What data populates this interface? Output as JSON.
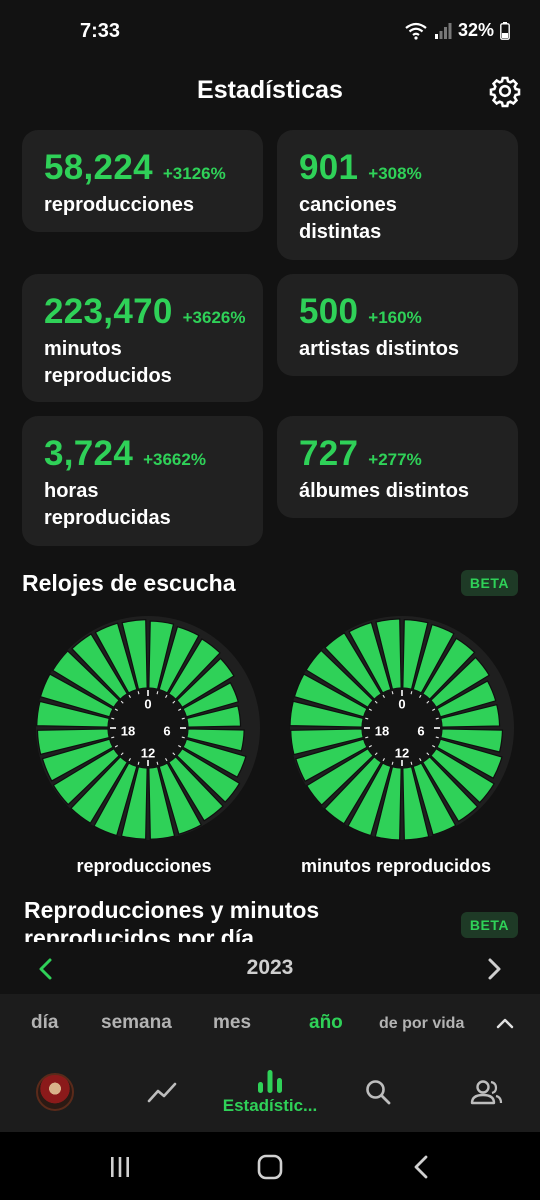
{
  "status_bar": {
    "time": "7:33",
    "battery": "32%"
  },
  "header": {
    "title": "Estadísticas"
  },
  "stats": [
    {
      "value": "58,224",
      "change": "+3126%",
      "label_lines": [
        "reproducciones"
      ]
    },
    {
      "value": "901",
      "change": "+308%",
      "label_lines": [
        "canciones",
        "distintas"
      ]
    },
    {
      "value": "223,470",
      "change": "+3626%",
      "label_lines": [
        "minutos",
        "reproducidos"
      ]
    },
    {
      "value": "500",
      "change": "+160%",
      "label_lines": [
        "artistas distintos"
      ]
    },
    {
      "value": "3,724",
      "change": "+3662%",
      "label_lines": [
        "horas",
        "reproducidas"
      ]
    },
    {
      "value": "727",
      "change": "+277%",
      "label_lines": [
        "álbumes distintos"
      ]
    }
  ],
  "clocks_section": {
    "title": "Relojes de escucha",
    "badge": "BETA",
    "clocks": [
      {
        "label": "reproducciones",
        "ticks": [
          "0",
          "6",
          "12",
          "18"
        ],
        "hour_levels": [
          0.93,
          0.91,
          0.89,
          0.84,
          0.75,
          0.73,
          0.78,
          0.86,
          0.93,
          0.95,
          0.98,
          0.99,
          0.99,
          1.0,
          0.99,
          0.98,
          0.97,
          0.98,
          0.99,
          1.0,
          0.99,
          0.97,
          0.96,
          0.95
        ]
      },
      {
        "label": "minutos reproducidos",
        "ticks": [
          "0",
          "6",
          "12",
          "18"
        ],
        "hour_levels": [
          0.95,
          0.94,
          0.9,
          0.86,
          0.8,
          0.8,
          0.84,
          0.89,
          0.94,
          0.96,
          0.99,
          1.0,
          1.0,
          1.0,
          1.0,
          0.99,
          0.98,
          0.99,
          1.0,
          1.0,
          1.0,
          0.99,
          0.97,
          0.96
        ]
      }
    ]
  },
  "daily_section": {
    "title_lines": [
      "Reproducciones y minutos",
      "reproducidos por día"
    ],
    "badge": "BETA",
    "year": "2023"
  },
  "period_tabs": {
    "items": [
      "día",
      "semana",
      "mes",
      "año",
      "de por vida"
    ],
    "active": "año"
  },
  "bottom_nav": {
    "active_label": "Estadístic..."
  },
  "colors": {
    "accent": "#2fd158",
    "card_bg": "#212121",
    "background": "#121212",
    "bar_bg": "#1c1c1c"
  }
}
